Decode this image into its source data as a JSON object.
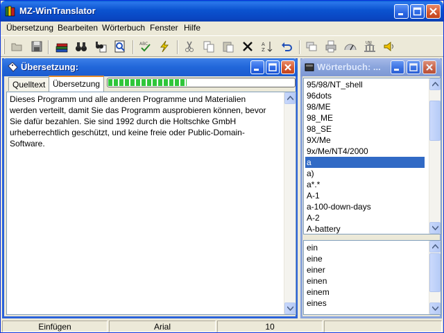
{
  "app": {
    "title": "MZ-WinTranslator",
    "colors": {
      "titlebar": "#0b53d0",
      "selection": "#316ac5",
      "progress": "#2fc63a"
    }
  },
  "menu": [
    "Übersetzung",
    "Bearbeiten",
    "Wörterbuch",
    "Fenster",
    "Hilfe"
  ],
  "toolbar": {
    "icons": [
      "open-folder-icon",
      "save-disk-icon",
      "books-icon",
      "binoculars-icon",
      "find-replace-icon",
      "search-page-icon",
      "spellcheck-icon",
      "lightning-icon",
      "cut-icon",
      "copy-icon",
      "paste-icon",
      "delete-icon",
      "sort-icon",
      "undo-icon",
      "windows-icon",
      "print-icon",
      "gauge-icon",
      "uni-building-icon",
      "speaker-icon"
    ]
  },
  "translation_window": {
    "title": "Übersetzung:",
    "tabs": [
      "Quelltext",
      "Übersetzung"
    ],
    "active_tab": "Übersetzung",
    "progress": 0.42,
    "text": "Dieses Programm und alle anderen Programme und Materialien werden verteilt, damit Sie das Programm ausprobieren können, bevor Sie dafür bezahlen. Sie sind 1992 durch die Holtschke GmbH urheberrechtlich geschützt, und keine freie oder Public-Domain-Software."
  },
  "dictionary_window": {
    "title": "Wörterbuch: ...",
    "entries": [
      "95/98/NT_shell",
      "96dots",
      "98/ME",
      "98_ME",
      "98_SE",
      "9X/Me",
      "9x/Me/NT4/2000",
      "a",
      "a)",
      "a*.*",
      "A-1",
      "a-100-down-days",
      "A-2",
      "A-battery"
    ],
    "selected_index": 7,
    "translations": [
      "ein",
      "eine",
      "einer",
      "einen",
      "einem",
      "eines"
    ]
  },
  "status": {
    "mode": "Einfügen",
    "font": "Arial",
    "size": "10"
  }
}
